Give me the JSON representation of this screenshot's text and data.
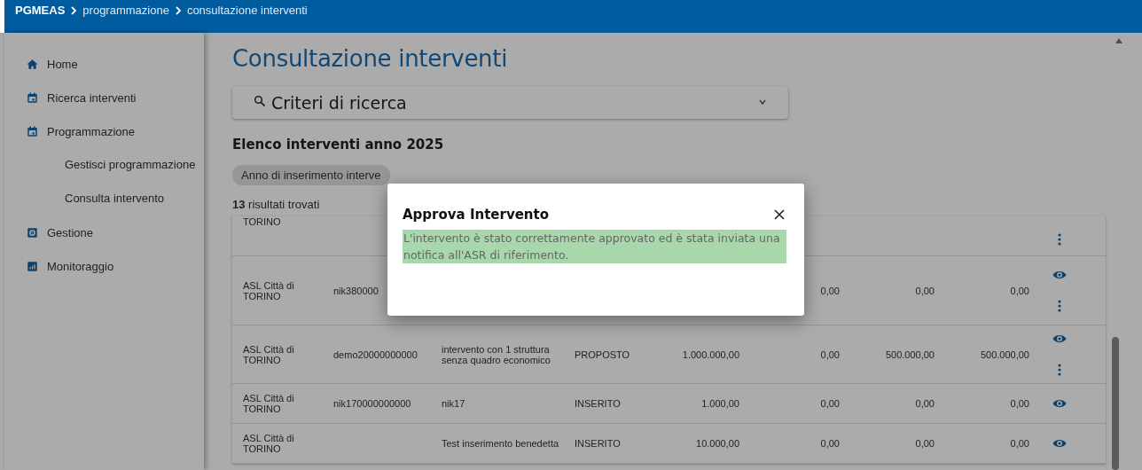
{
  "breadcrumb": [
    {
      "label": "PGMEAS"
    },
    {
      "label": "programmazione"
    },
    {
      "label": "consultazione interventi"
    }
  ],
  "sidebar": {
    "items": [
      {
        "label": "Home"
      },
      {
        "label": "Ricerca interventi"
      },
      {
        "label": "Programmazione",
        "children": [
          {
            "label": "Gestisci programmazione"
          },
          {
            "label": "Consulta intervento"
          }
        ]
      },
      {
        "label": "Gestione"
      },
      {
        "label": "Monitoraggio"
      }
    ]
  },
  "page_title": "Consultazione interventi",
  "search_panel": {
    "title": "Criteri di ricerca",
    "expanded": false
  },
  "list_title": "Elenco interventi anno 2025",
  "filter_chip": {
    "label": "Anno di inserimento interve"
  },
  "results": {
    "count": "13",
    "label": "risultati trovati"
  },
  "table": {
    "rows": [
      {
        "cells": [
          "TORINO",
          "",
          "",
          "",
          "",
          "",
          "",
          ""
        ],
        "view": false,
        "menu": true
      },
      {
        "cells": [
          "ASL Città di TORINO",
          "nik380000",
          "",
          "",
          "",
          "0,00",
          "0,00",
          "0,00"
        ],
        "view": true,
        "menu": true
      },
      {
        "cells": [
          "ASL Città di TORINO",
          "demo20000000000",
          "intervento con 1 struttura senza quadro economico",
          "PROPOSTO",
          "1.000.000,00",
          "0,00",
          "500.000,00",
          "500.000,00"
        ],
        "view": true,
        "menu": true
      },
      {
        "cells": [
          "ASL Città di TORINO",
          "nik170000000000",
          "nik17",
          "INSERITO",
          "1.000,00",
          "0,00",
          "0,00",
          "0,00"
        ],
        "view": true,
        "menu": false
      },
      {
        "cells": [
          "ASL Città di TORINO",
          "",
          "Test inserimento benedetta",
          "INSERITO",
          "10.000,00",
          "0,00",
          "0,00",
          "0,00"
        ],
        "view": true,
        "menu": false
      }
    ]
  },
  "dialog": {
    "title": "Approva Intervento",
    "message": "L'intervento è stato correttamente approvato ed è stata inviata una notifica all'ASR di riferimento."
  }
}
